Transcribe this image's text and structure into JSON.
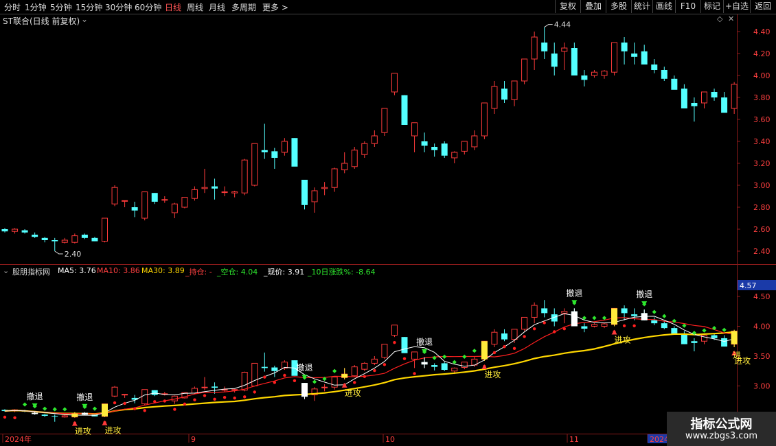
{
  "toolbar": {
    "periods": [
      "分时",
      "1分钟",
      "5分钟",
      "15分钟",
      "30分钟",
      "60分钟",
      "日线",
      "周线",
      "月线",
      "多周期",
      "更多 >"
    ],
    "active_period": "日线",
    "actions": [
      "复权",
      "叠加",
      "多股",
      "统计",
      "画线",
      "F10",
      "标记",
      "+自选",
      "返回"
    ]
  },
  "main_chart": {
    "title": "ST联合(日线 前复权)",
    "y_ticks": [
      "4.40",
      "4.20",
      "4.00",
      "3.80",
      "3.60",
      "3.40",
      "3.20",
      "3.00",
      "2.80",
      "2.60",
      "2.40"
    ],
    "high_label": "4.44",
    "low_label": "2.40"
  },
  "indicator": {
    "name": "股朋指标网",
    "ma5": "MA5: 3.76",
    "ma10": "MA10: 3.86",
    "ma30": "MA30: 3.89",
    "hold": "_持仓: -",
    "empty": "_空仓: 4.04",
    "price": "_现价: 3.91",
    "change": "_10日涨跌%: -8.64",
    "y_ticks": [
      "4.50",
      "4.00",
      "3.50",
      "3.00"
    ],
    "current_tag": "4.57",
    "retreat_label": "撤退",
    "attack_label": "进攻",
    "attack_edge_label": "进"
  },
  "x_axis": {
    "labels": [
      "2024年",
      "9",
      "10",
      "11",
      "2024"
    ]
  },
  "colors": {
    "up": "#ff3b3b",
    "down": "#54ffff",
    "ma5": "#ffffff",
    "ma10": "#ff2020",
    "ma30": "#ffd700",
    "hold_dot": "#ff2020",
    "empty_dot": "#2ee82e",
    "signal_yellow": "#ffeb3b"
  },
  "chart_data": {
    "type": "candlestick",
    "series": [
      {
        "ohlc": [
          [
            2.6,
            2.61,
            2.57,
            2.58
          ],
          [
            2.58,
            2.61,
            2.56,
            2.6
          ],
          [
            2.59,
            2.6,
            2.56,
            2.57
          ],
          [
            2.55,
            2.57,
            2.52,
            2.53
          ],
          [
            2.52,
            2.53,
            2.48,
            2.5
          ],
          [
            2.5,
            2.52,
            2.4,
            2.49
          ],
          [
            2.48,
            2.52,
            2.47,
            2.5
          ],
          [
            2.48,
            2.56,
            2.47,
            2.54
          ],
          [
            2.55,
            2.56,
            2.51,
            2.52
          ],
          [
            2.52,
            2.53,
            2.49,
            2.49
          ],
          [
            2.49,
            2.7,
            2.48,
            2.7
          ],
          [
            2.83,
            3.0,
            2.81,
            2.98
          ],
          [
            2.86,
            2.86,
            2.8,
            2.86
          ],
          [
            2.8,
            2.85,
            2.71,
            2.77
          ],
          [
            2.7,
            2.94,
            2.68,
            2.94
          ],
          [
            2.93,
            2.93,
            2.83,
            2.85
          ],
          [
            2.87,
            2.9,
            2.84,
            2.87
          ],
          [
            2.75,
            2.84,
            2.7,
            2.83
          ],
          [
            2.8,
            2.89,
            2.79,
            2.89
          ],
          [
            2.88,
            2.99,
            2.86,
            2.96
          ],
          [
            2.97,
            3.15,
            2.93,
            2.98
          ],
          [
            2.99,
            3.06,
            2.87,
            2.97
          ],
          [
            2.94,
            2.99,
            2.9,
            2.94
          ],
          [
            2.93,
            2.95,
            2.89,
            2.94
          ],
          [
            2.93,
            3.24,
            2.91,
            3.23
          ],
          [
            3.0,
            3.38,
            2.99,
            3.38
          ],
          [
            3.32,
            3.56,
            3.24,
            3.3
          ],
          [
            3.31,
            3.34,
            3.15,
            3.25
          ],
          [
            3.3,
            3.43,
            3.27,
            3.4
          ],
          [
            3.43,
            3.43,
            3.18,
            3.17
          ],
          [
            3.05,
            3.05,
            2.78,
            2.82
          ],
          [
            2.85,
            2.98,
            2.75,
            2.95
          ],
          [
            2.97,
            3.03,
            2.91,
            2.98
          ],
          [
            2.98,
            3.16,
            2.94,
            3.15
          ],
          [
            3.14,
            3.3,
            3.11,
            3.2
          ],
          [
            3.17,
            3.35,
            3.15,
            3.32
          ],
          [
            3.28,
            3.4,
            3.25,
            3.38
          ],
          [
            3.38,
            3.5,
            3.35,
            3.45
          ],
          [
            3.48,
            3.68,
            3.45,
            3.7
          ],
          [
            3.85,
            4.02,
            3.82,
            4.02
          ],
          [
            3.82,
            3.82,
            3.55,
            3.55
          ],
          [
            3.45,
            3.57,
            3.3,
            3.57
          ],
          [
            3.4,
            3.48,
            3.3,
            3.36
          ],
          [
            3.35,
            3.38,
            3.26,
            3.32
          ],
          [
            3.38,
            3.4,
            3.25,
            3.27
          ],
          [
            3.25,
            3.31,
            3.2,
            3.3
          ],
          [
            3.31,
            3.4,
            3.28,
            3.4
          ],
          [
            3.35,
            3.5,
            3.32,
            3.45
          ],
          [
            3.45,
            3.75,
            3.42,
            3.75
          ],
          [
            3.7,
            3.95,
            3.65,
            3.9
          ],
          [
            3.88,
            3.95,
            3.75,
            3.78
          ],
          [
            3.78,
            3.93,
            3.72,
            3.95
          ],
          [
            3.95,
            4.15,
            3.92,
            4.15
          ],
          [
            4.15,
            4.4,
            4.05,
            4.35
          ],
          [
            4.3,
            4.44,
            4.15,
            4.22
          ],
          [
            4.2,
            4.3,
            4.0,
            4.08
          ],
          [
            4.22,
            4.3,
            4.05,
            4.25
          ],
          [
            4.25,
            4.3,
            4.0,
            4.0
          ],
          [
            4.0,
            4.05,
            3.9,
            3.96
          ],
          [
            4.0,
            4.05,
            3.98,
            4.03
          ],
          [
            4.0,
            4.05,
            3.97,
            4.04
          ],
          [
            4.03,
            4.3,
            4.0,
            4.3
          ],
          [
            4.3,
            4.35,
            4.1,
            4.22
          ],
          [
            4.2,
            4.3,
            4.1,
            4.17
          ],
          [
            4.22,
            4.28,
            4.1,
            4.1
          ],
          [
            4.1,
            4.15,
            4.02,
            4.05
          ],
          [
            4.05,
            4.08,
            3.95,
            3.97
          ],
          [
            3.97,
            4.0,
            3.88,
            3.87
          ],
          [
            3.88,
            3.92,
            3.7,
            3.7
          ],
          [
            3.75,
            3.8,
            3.58,
            3.72
          ],
          [
            3.75,
            3.84,
            3.7,
            3.85
          ],
          [
            3.85,
            3.88,
            3.77,
            3.8
          ],
          [
            3.8,
            3.85,
            3.66,
            3.66
          ],
          [
            3.7,
            3.94,
            3.65,
            3.92
          ]
        ]
      }
    ],
    "x_labels": [
      "2024年",
      "9",
      "10",
      "11",
      "2024"
    ],
    "ylim": [
      2.3,
      4.5
    ]
  }
}
